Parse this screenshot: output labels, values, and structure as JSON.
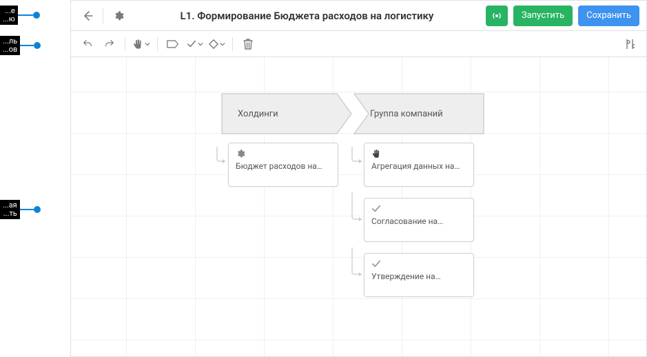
{
  "annotations": {
    "a1": "...е\n...ю",
    "a2": "...ль\n...ов",
    "a3": "...ая\n...ть"
  },
  "header": {
    "title": "L1. Формирование Бюджета расходов на логистику",
    "run": "Запустить",
    "save": "Сохранить"
  },
  "stages": {
    "s1": "Холдинги",
    "s2": "Группа компаний"
  },
  "cards": {
    "c1": "Бюджет расходов на…",
    "c2": "Агрегация данных на…",
    "c3": "Согласование на…",
    "c4": "Утверждение на…"
  }
}
